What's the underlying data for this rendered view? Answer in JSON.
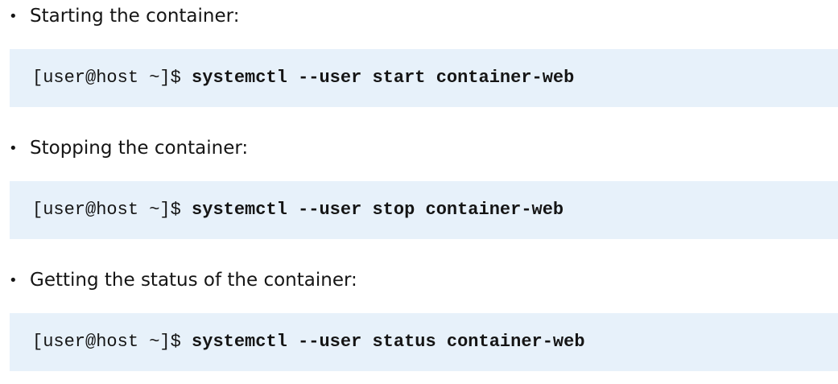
{
  "items": [
    {
      "bullet": "•",
      "text": "Starting the container:",
      "prompt": "[user@host ~]$ ",
      "command": "systemctl --user start container-web"
    },
    {
      "bullet": "•",
      "text": "Stopping the container:",
      "prompt": "[user@host ~]$ ",
      "command": "systemctl --user stop container-web"
    },
    {
      "bullet": "•",
      "text": "Getting the status of the container:",
      "prompt": "[user@host ~]$ ",
      "command": "systemctl --user status container-web"
    }
  ],
  "colors": {
    "code_background": "#e7f1fa",
    "text": "#151515"
  }
}
